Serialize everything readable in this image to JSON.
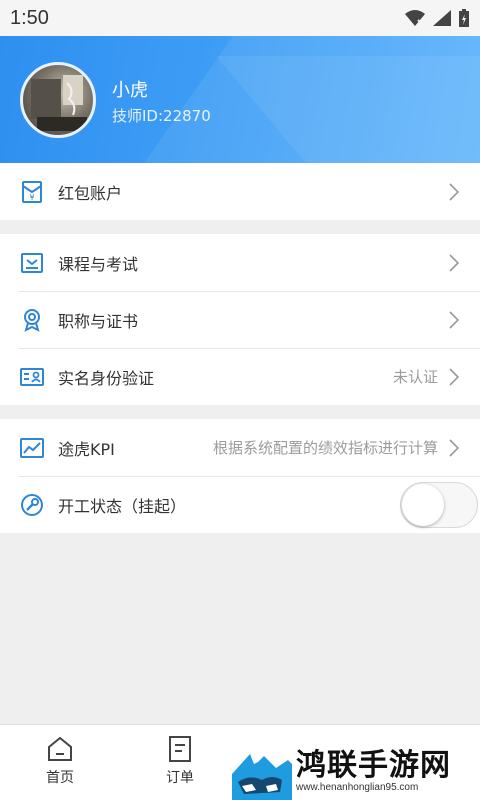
{
  "status_bar": {
    "time": "1:50"
  },
  "profile": {
    "name": "小虎",
    "tech_id": "技师ID:22870"
  },
  "sections": [
    {
      "items": [
        {
          "label": "红包账户",
          "icon": "red-envelope-icon"
        }
      ]
    },
    {
      "items": [
        {
          "label": "课程与考试",
          "icon": "course-icon"
        },
        {
          "label": "职称与证书",
          "icon": "award-icon"
        },
        {
          "label": "实名身份验证",
          "icon": "id-card-icon",
          "value": "未认证"
        }
      ]
    },
    {
      "items": [
        {
          "label": "途虎KPI",
          "icon": "chart-icon",
          "value": "根据系统配置的绩效指标进行计算"
        },
        {
          "label": "开工状态（挂起）",
          "icon": "wrench-icon",
          "toggle": false
        }
      ]
    }
  ],
  "tabbar": [
    {
      "label": "首页",
      "icon": "home-icon"
    },
    {
      "label": "订单",
      "icon": "order-icon"
    }
  ],
  "watermark": {
    "title": "鸿联手游网",
    "url": "www.henanhonglian95.com"
  },
  "colors": {
    "header_accent": "#3c9cf5",
    "icon_blue": "#2e86d6",
    "background": "#efefef"
  }
}
